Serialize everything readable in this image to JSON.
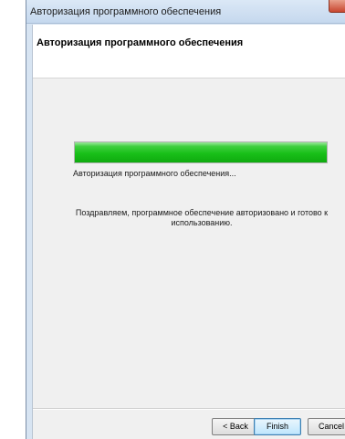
{
  "window": {
    "title": "Авторизация программного обеспечения"
  },
  "header": {
    "title": "Авторизация программного обеспечения"
  },
  "progress": {
    "value_percent": 100,
    "color": "#19c019",
    "status_text": "Авторизация программного обеспечения..."
  },
  "message": {
    "text": "Поздравляем, программное обеспечение авторизовано и готово к использованию."
  },
  "buttons": {
    "back_label": "< Back",
    "finish_label": "Finish",
    "cancel_label": "Cancel"
  },
  "icons": {
    "close": "close-icon"
  }
}
